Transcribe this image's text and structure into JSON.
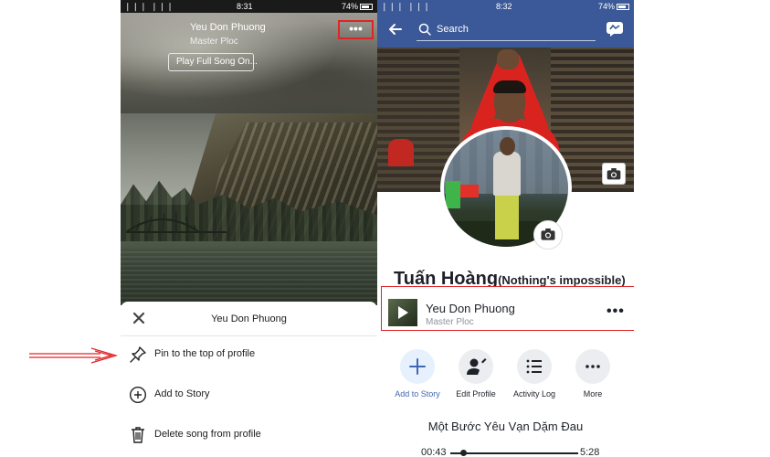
{
  "left_phone": {
    "status": {
      "signal": "❘❘❘ ❘❘❘",
      "time": "8:31",
      "battery": "74%"
    },
    "cover": {
      "song_title": "Yeu Don Phuong",
      "artist": "Master Ploc",
      "play_full_label": "Play Full Song On...",
      "more_label": "•••"
    },
    "sheet": {
      "title": "Yeu Don Phuong",
      "items": [
        {
          "label": "Pin to the top of profile",
          "icon": "pin-icon"
        },
        {
          "label": "Add to Story",
          "icon": "add-circle-icon"
        },
        {
          "label": "Delete song from profile",
          "icon": "trash-icon"
        }
      ]
    }
  },
  "right_phone": {
    "status": {
      "signal": "❘❘❘ ❘❘❘",
      "time": "8:32",
      "battery": "74%"
    },
    "navbar": {
      "search_placeholder": "Search"
    },
    "profile": {
      "name": "Tuấn Hoàng",
      "nickname": "(Nothing's impossible)"
    },
    "music": {
      "title": "Yeu Don Phuong",
      "artist": "Master Ploc",
      "more_label": "•••"
    },
    "actions": [
      {
        "label": "Add to Story",
        "icon": "plus-icon"
      },
      {
        "label": "Edit Profile",
        "icon": "edit-profile-icon"
      },
      {
        "label": "Activity Log",
        "icon": "list-icon"
      },
      {
        "label": "More",
        "icon": "more-icon"
      }
    ],
    "now_playing": {
      "song": "Một Bước Yêu Vạn Dặm Đau",
      "current_time": "00:43",
      "total_time": "5:28",
      "progress": 0.1
    }
  },
  "colors": {
    "facebook_blue": "#3b5998",
    "highlight_red": "#e02424",
    "link_blue": "#4267b2"
  }
}
